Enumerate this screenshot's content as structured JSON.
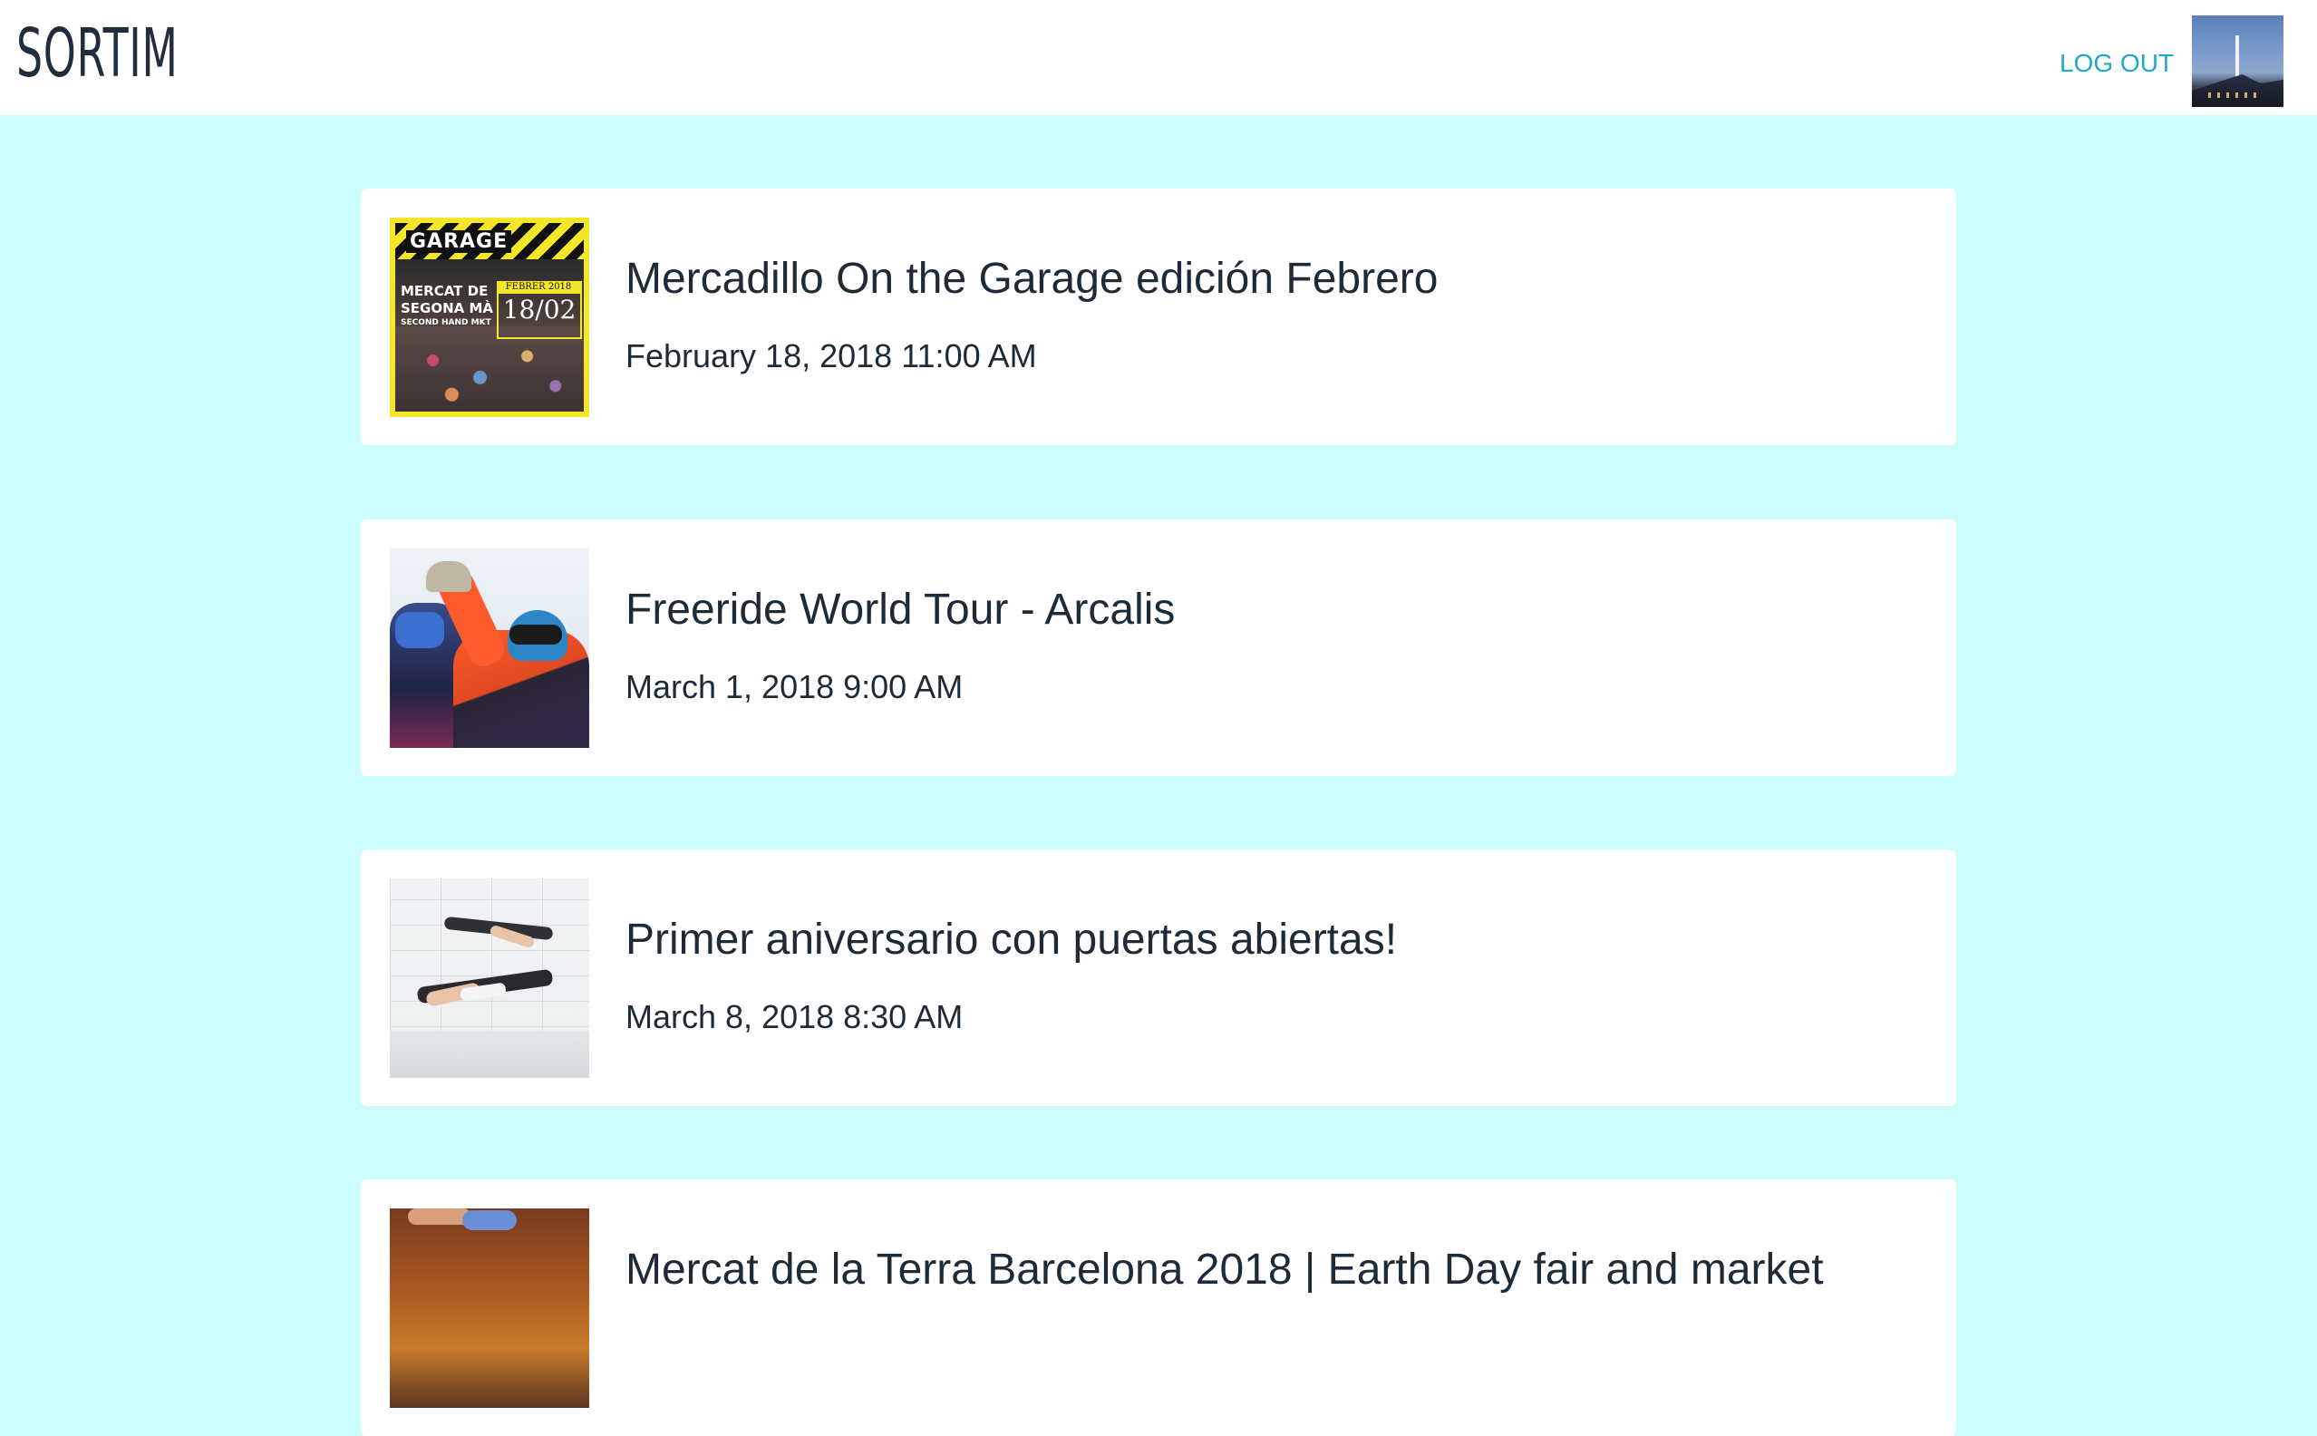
{
  "header": {
    "logo": "SORTIM",
    "logout_label": "LOG OUT"
  },
  "events": [
    {
      "title": "Mercadillo On the Garage edición Febrero",
      "date": "February 18, 2018 11:00 AM",
      "thumb_text": {
        "brand": "GARAGE",
        "line1": "MERCAT DE",
        "line2": "SEGONA MÀ",
        "line3": "SECOND HAND MKT",
        "tag": "FEBRER 2018",
        "day": "18/02"
      }
    },
    {
      "title": "Freeride World Tour - Arcalis",
      "date": "March 1, 2018 9:00 AM"
    },
    {
      "title": "Primer aniversario con puertas abiertas!",
      "date": "March 8, 2018 8:30 AM"
    },
    {
      "title": "Mercat de la Terra Barcelona 2018 | Earth Day fair and market",
      "date": ""
    }
  ],
  "colors": {
    "background": "#ccfcfc",
    "accent": "#21a6cc",
    "text": "#1d2b38"
  }
}
